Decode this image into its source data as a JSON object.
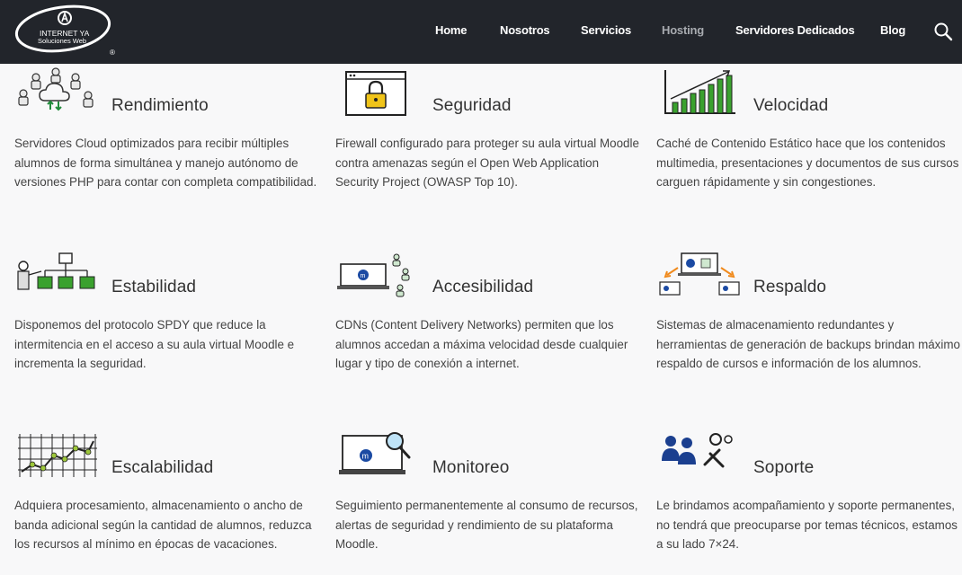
{
  "header": {
    "logo_text_line1": "INTERNET YA",
    "logo_text_line2": "Soluciones Web",
    "logo_registered": "®",
    "nav": [
      {
        "label": "Home",
        "active": false
      },
      {
        "label": "Nosotros",
        "active": false
      },
      {
        "label": "Servicios",
        "active": false
      },
      {
        "label": "Hosting",
        "active": true
      },
      {
        "label": "Servidores Dedicados",
        "active": false
      },
      {
        "label": "Blog",
        "active": false
      }
    ],
    "search_icon": "search-icon"
  },
  "features": [
    {
      "title": "Rendimiento",
      "icon": "cloud-users-icon",
      "text": "Servidores Cloud optimizados para recibir múltiples alumnos de forma simultánea y manejo autónomo de versiones PHP para contar con completa compatibilidad."
    },
    {
      "title": "Seguridad",
      "icon": "browser-lock-icon",
      "text": "Firewall configurado para proteger su aula virtual Moodle contra amenazas según el Open Web Application Security Project (OWASP Top 10)."
    },
    {
      "title": "Velocidad",
      "icon": "bar-chart-icon",
      "text": "Caché de Contenido Estático hace que los contenidos multimedia, presentaciones y documentos de sus cursos carguen rápidamente y sin congestiones."
    },
    {
      "title": "Estabilidad",
      "icon": "presenter-diagram-icon",
      "text": "Disponemos del protocolo SPDY que reduce la intermitencia en el acceso a su aula virtual Moodle e incrementa la seguridad."
    },
    {
      "title": "Accesibilidad",
      "icon": "laptop-users-icon",
      "text": "CDNs (Content Delivery Networks) permiten que los alumnos accedan a máxima velocidad desde cualquier lugar y tipo de conexión a internet."
    },
    {
      "title": "Respaldo",
      "icon": "laptop-backup-icon",
      "text": "Sistemas de almacenamiento redundantes y herramientas de generación de backups brindan máximo respaldo de cursos e información de los alumnos."
    },
    {
      "title": "Escalabilidad",
      "icon": "line-graph-icon",
      "text": "Adquiera procesamiento, almacenamiento o ancho de banda adicional según la cantidad de alumnos, reduzca los recursos al mínimo en épocas de vacaciones."
    },
    {
      "title": "Monitoreo",
      "icon": "laptop-magnifier-icon",
      "text": "Seguimiento permanentemente al consumo de recursos, alertas de seguridad y rendimiento de su plataforma Moodle."
    },
    {
      "title": "Soporte",
      "icon": "support-tools-icon",
      "text": "Le brindamos acompañamiento y soporte permanentes, no tendrá que preocuparse por temas técnicos, estamos a su lado 7×24."
    }
  ],
  "colors": {
    "header_bg": "#22252b",
    "nav_active": "#a8abb0",
    "accent_green": "#3aa12e",
    "accent_blue": "#1b4aa3",
    "accent_yellow": "#f0c419",
    "accent_orange": "#f08a1c"
  }
}
